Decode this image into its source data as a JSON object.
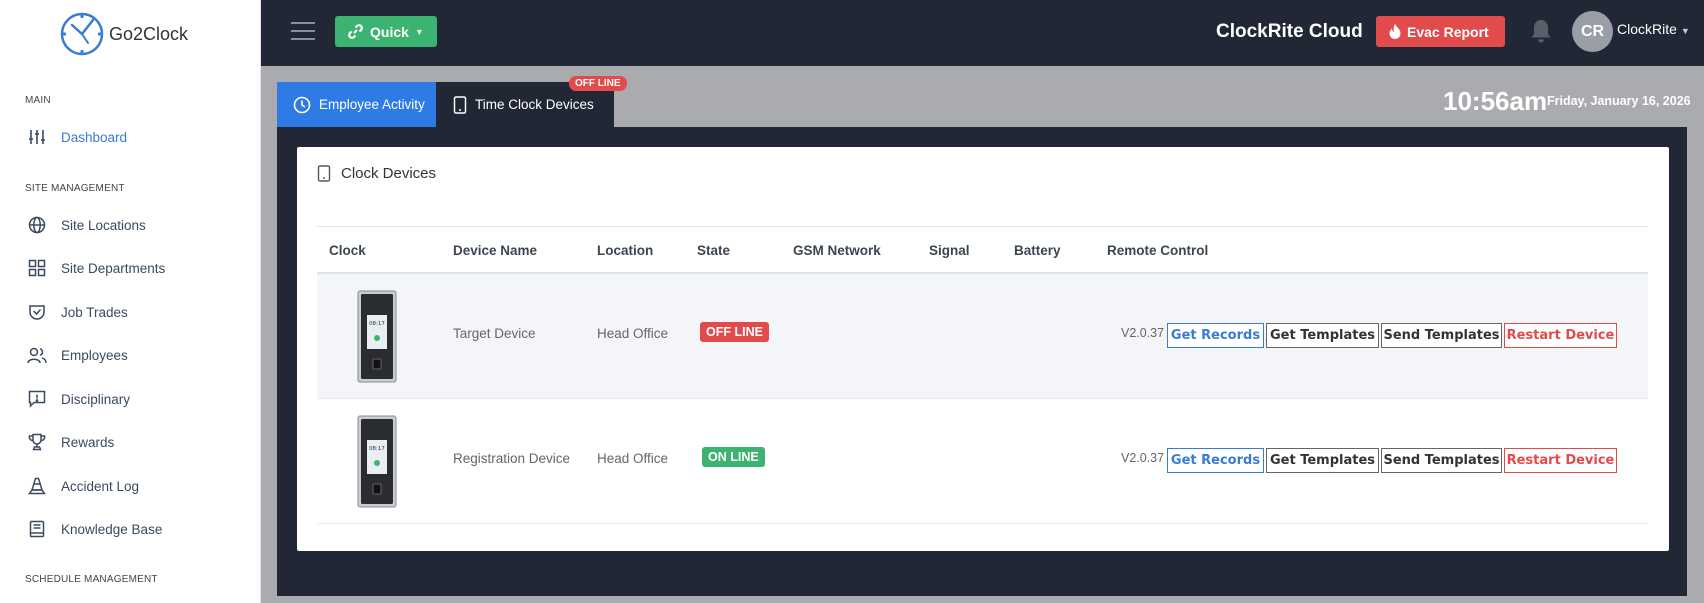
{
  "brand": {
    "name": "Go2Clock"
  },
  "sidebar": {
    "sections": {
      "main": "MAIN",
      "site_management": "SITE MANAGEMENT",
      "schedule_management": "SCHEDULE MANAGEMENT"
    },
    "items": [
      {
        "label": "Dashboard",
        "icon": "sliders-icon",
        "active": true
      },
      {
        "label": "Site Locations",
        "icon": "globe-icon"
      },
      {
        "label": "Site Departments",
        "icon": "grid-icon"
      },
      {
        "label": "Job Trades",
        "icon": "shield-check-icon"
      },
      {
        "label": "Employees",
        "icon": "users-icon"
      },
      {
        "label": "Disciplinary",
        "icon": "message-alert-icon"
      },
      {
        "label": "Rewards",
        "icon": "trophy-icon"
      },
      {
        "label": "Accident Log",
        "icon": "cone-icon"
      },
      {
        "label": "Knowledge Base",
        "icon": "book-icon"
      }
    ]
  },
  "topbar": {
    "quick_label": "Quick",
    "app_title": "ClockRite Cloud",
    "evac_label": "Evac Report",
    "avatar_initials": "CR",
    "username": "ClockRite"
  },
  "tabs": {
    "employee_activity": "Employee Activity",
    "time_clock_devices": "Time Clock Devices",
    "devices_badge": "OFF LINE"
  },
  "clock": {
    "time": "10:56am",
    "date": "Friday, January 16, 2026"
  },
  "card": {
    "title": "Clock Devices",
    "columns": [
      "Clock",
      "Device Name",
      "Location",
      "State",
      "GSM Network",
      "Signal",
      "Battery",
      "Remote Control"
    ],
    "rows": [
      {
        "device_name": "Target Device",
        "location": "Head Office",
        "state": "OFF LINE",
        "version": "V2.0.37"
      },
      {
        "device_name": "Registration Device",
        "location": "Head Office",
        "state": "ON LINE",
        "version": "V2.0.37"
      }
    ],
    "actions": {
      "get_records": "Get Records",
      "get_templates": "Get Templates",
      "send_templates": "Send Templates",
      "restart_device": "Restart Device"
    }
  },
  "colors": {
    "accent": "#2e7be6",
    "success": "#3cb371",
    "danger": "#e14b4b",
    "dark": "#222736"
  },
  "device_screen_time": "08:17"
}
